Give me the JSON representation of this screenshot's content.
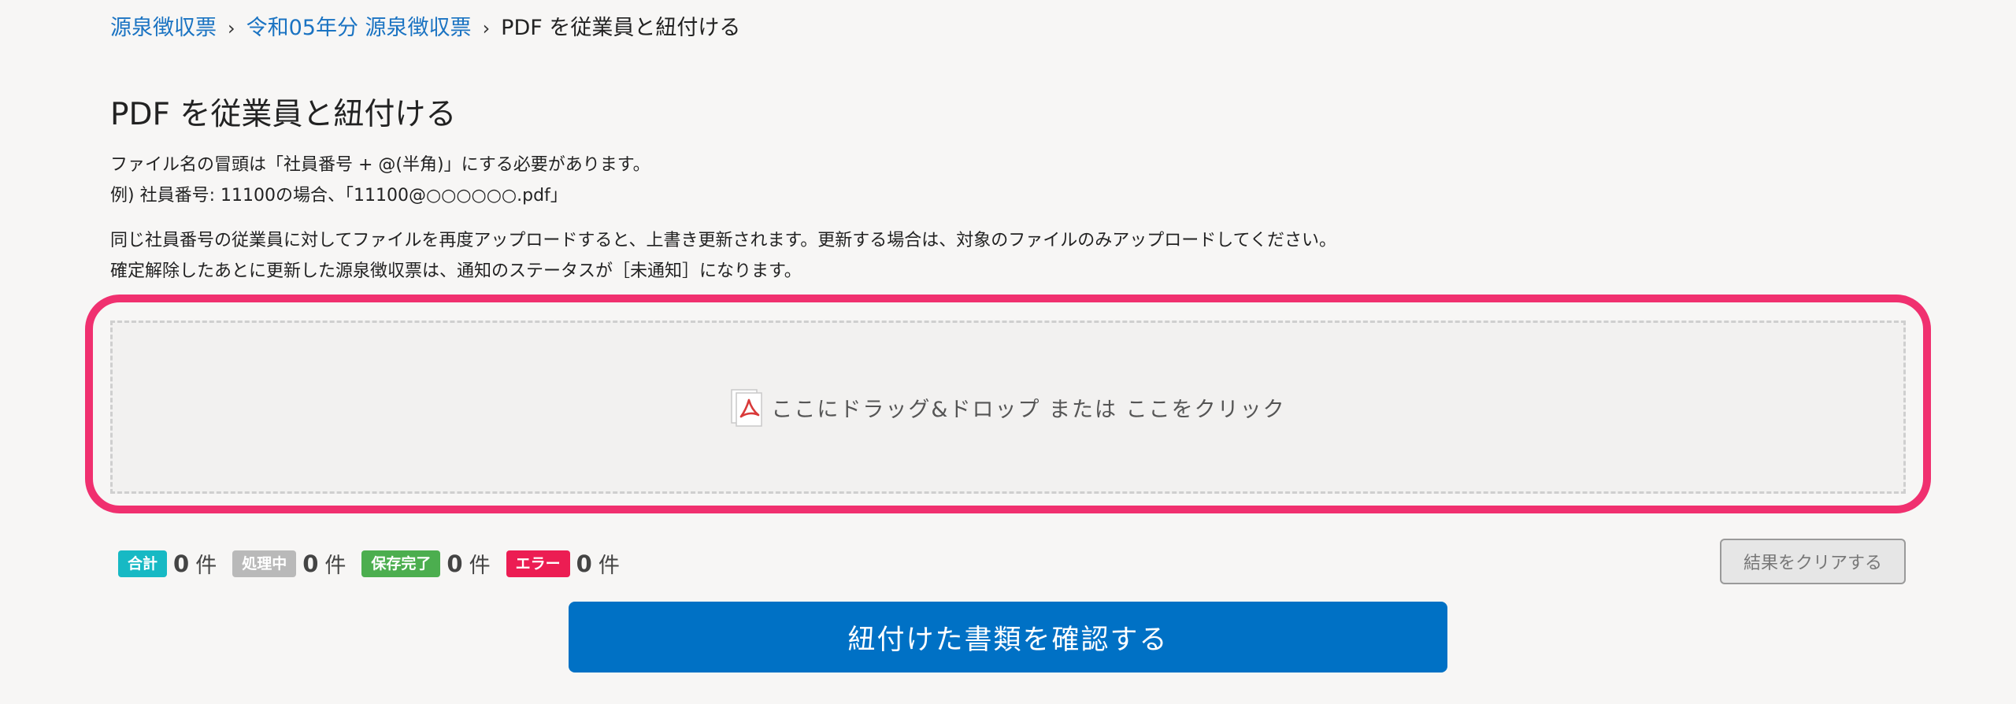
{
  "breadcrumb": {
    "items": [
      "源泉徴収票",
      "令和05年分 源泉徴収票"
    ],
    "current": "PDF を従業員と紐付ける",
    "separator": "›"
  },
  "page": {
    "title": "PDF を従業員と紐付ける",
    "desc1": [
      "ファイル名の冒頭は「社員番号 + @(半角)」にする必要があります。",
      "例) 社員番号: 11100の場合、「11100@○○○○○○.pdf」"
    ],
    "desc2": [
      "同じ社員番号の従業員に対してファイルを再度アップロードすると、上書き更新されます。更新する場合は、対象のファイルのみアップロードしてください。",
      "確定解除したあとに更新した源泉徴収票は、通知のステータスが［未通知］になります。"
    ]
  },
  "dropzone": {
    "icon": "pdf-file-icon",
    "text": "ここにドラッグ&ドロップ または ここをクリック",
    "highlight_color": "#f0306f"
  },
  "status": {
    "items": [
      {
        "label": "合計",
        "count": "0",
        "unit": "件",
        "color": "#17b9c4"
      },
      {
        "label": "処理中",
        "count": "0",
        "unit": "件",
        "color": "#b9b9b9"
      },
      {
        "label": "保存完了",
        "count": "0",
        "unit": "件",
        "color": "#4cae4f"
      },
      {
        "label": "エラー",
        "count": "0",
        "unit": "件",
        "color": "#ec1d53"
      }
    ],
    "clear_label": "結果をクリアする"
  },
  "actions": {
    "confirm_label": "紐付けた書類を確認する",
    "confirm_color": "#0071c5"
  }
}
